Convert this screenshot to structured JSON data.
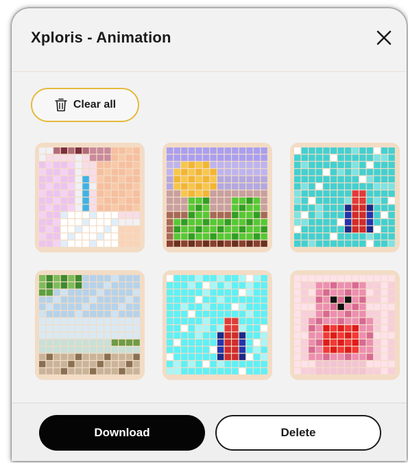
{
  "dialog": {
    "title": "Xploris - Animation",
    "close_icon": "close-icon"
  },
  "toolbar": {
    "clear_all_label": "Clear all",
    "clear_all_icon": "trash-icon",
    "accent_border": "#e5b93a"
  },
  "gallery": {
    "frame_color": "#f3dcc5",
    "items": [
      {
        "name": "pastel-portrait",
        "icon": "pixel-art-portrait"
      },
      {
        "name": "sunflower",
        "icon": "pixel-art-sunflower"
      },
      {
        "name": "ladybug-on-water",
        "icon": "pixel-art-bug"
      },
      {
        "name": "beach-landscape",
        "icon": "pixel-art-landscape"
      },
      {
        "name": "ladybug-on-ice",
        "icon": "pixel-art-bug"
      },
      {
        "name": "pink-teddy-bear",
        "icon": "pixel-art-bear"
      }
    ]
  },
  "footer": {
    "download_label": "Download",
    "delete_label": "Delete"
  },
  "colors": {
    "dialog_bg": "#f2f2f2",
    "primary_button": "#050505"
  }
}
